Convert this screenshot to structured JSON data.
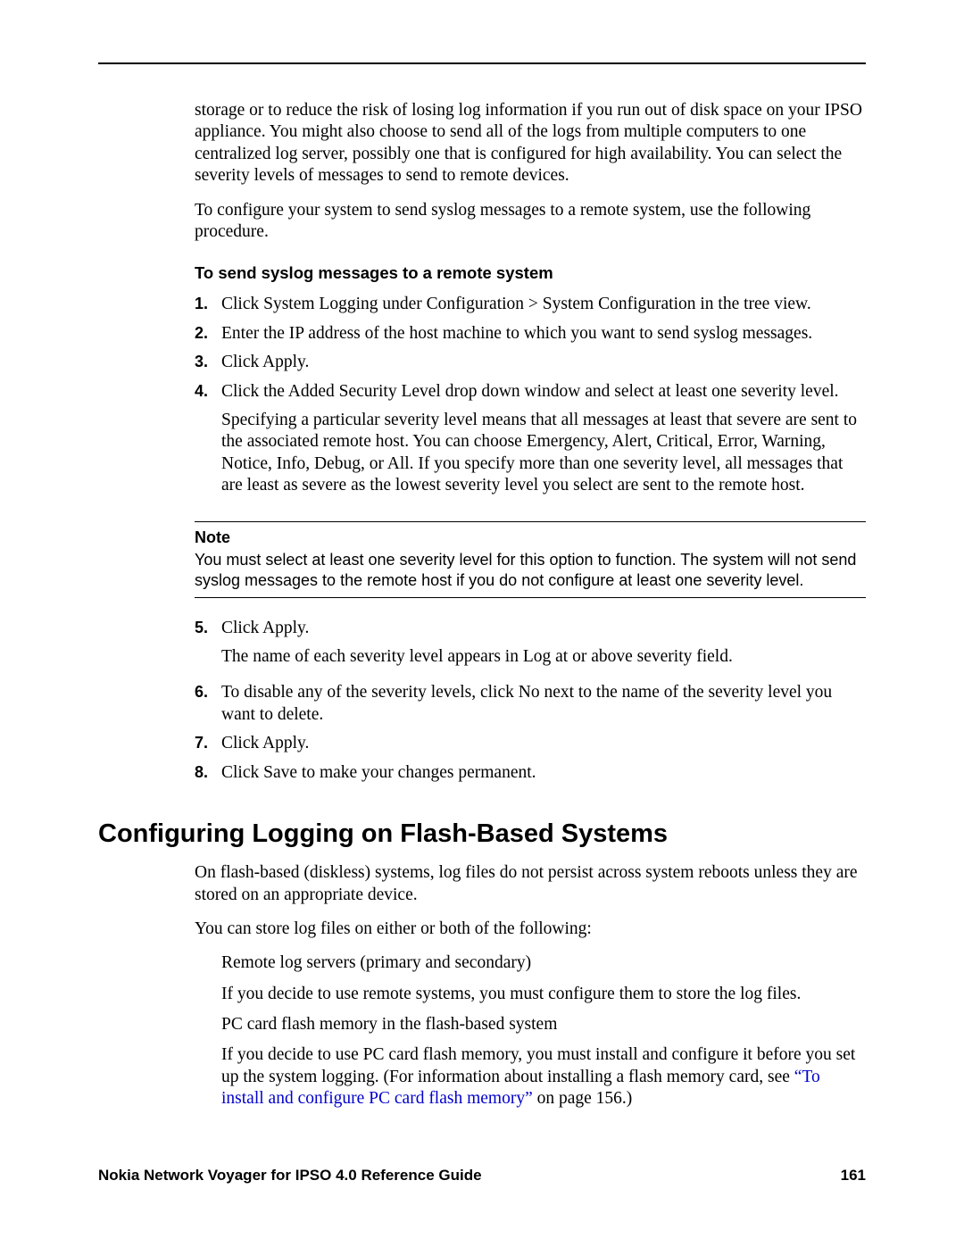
{
  "intro": {
    "p1": "storage or to reduce the risk of losing log information if you run out of disk space on your IPSO appliance. You might also choose to send all of the logs from multiple computers to one centralized log server, possibly one that is configured for high availability. You can select the severity levels of messages to send to remote devices.",
    "p2": "To configure your system to send syslog messages to a remote system, use the following procedure."
  },
  "procedure": {
    "heading": "To send syslog messages to a remote system",
    "steps": [
      {
        "n": "1.",
        "text": "Click System Logging under Configuration > System Configuration in the tree view."
      },
      {
        "n": "2.",
        "text": "Enter the IP address of the host machine to which you want to send syslog messages."
      },
      {
        "n": "3.",
        "text": "Click Apply."
      },
      {
        "n": "4.",
        "text": "Click the Added Security Level drop down window and select at least one severity level.",
        "extra": "Specifying a particular severity level means that all messages at least that severe are sent to the associated remote host. You can choose Emergency, Alert, Critical, Error, Warning, Notice, Info, Debug, or All. If you specify more than one severity level, all messages that are least as severe as the lowest severity level you select are sent to the remote host."
      }
    ],
    "note": {
      "title": "Note",
      "body": "You must select at least one severity level for this option to function. The system will not send syslog messages to the remote host if you do not configure at least one severity level."
    },
    "steps2": [
      {
        "n": "5.",
        "text": "Click Apply.",
        "extra": "The name of each severity level appears in Log at or above severity field."
      },
      {
        "n": "6.",
        "text": "To disable any of the severity levels, click No next to the name of the severity level you want to delete."
      },
      {
        "n": "7.",
        "text": "Click Apply."
      },
      {
        "n": "8.",
        "text": "Click Save to make your changes permanent."
      }
    ]
  },
  "section2": {
    "heading": "Configuring Logging on Flash-Based Systems",
    "p1": "On flash-based (diskless) systems, log files do not persist across system reboots unless they are stored on an appropriate device.",
    "p2": "You can store log files on either or both of the following:",
    "bullets": [
      {
        "l1": "Remote log servers (primary and secondary)",
        "l2": "If you decide to use remote systems, you must configure them to store the log files."
      },
      {
        "l1": "PC card flash memory in the flash-based system",
        "l2_pre": "If you decide to use PC card flash memory, you must install and configure it before you set up the system logging. (For information about installing a flash memory card, see ",
        "link": "“To install and configure PC card flash memory”",
        "l2_post": " on page 156.)"
      }
    ]
  },
  "footer": {
    "title": "Nokia Network Voyager for IPSO 4.0 Reference Guide",
    "page": "161"
  }
}
